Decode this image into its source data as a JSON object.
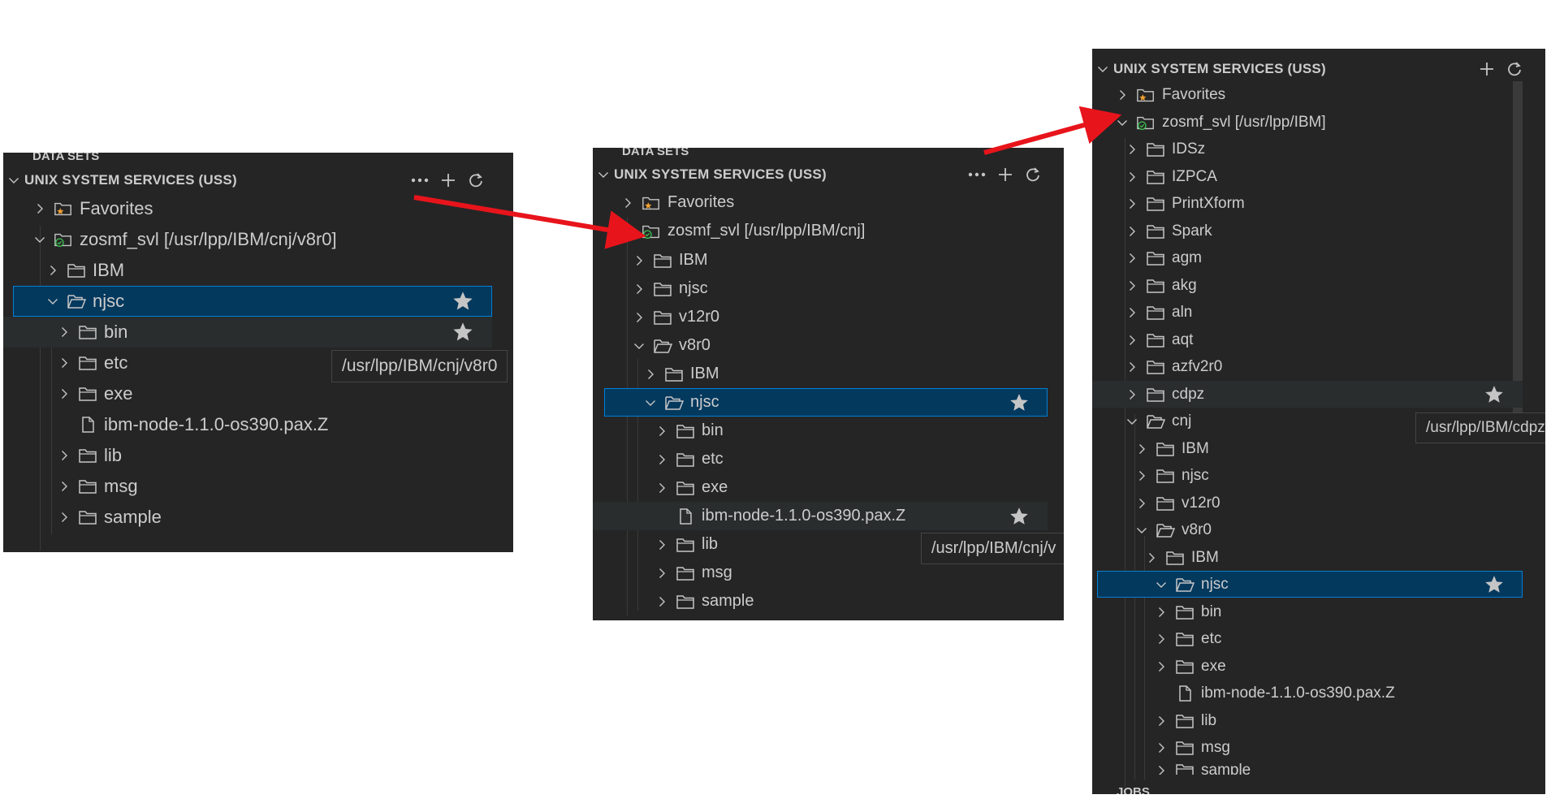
{
  "section_title": "UNIX SYSTEM SERVICES (USS)",
  "datasets_title": "DATA SETS",
  "jobs_title": "JOBS",
  "panel1": {
    "favorites": "Favorites",
    "profile": "zosmf_svl [/usr/lpp/IBM/cnj/v8r0]",
    "items": [
      "IBM",
      "njsc",
      "bin",
      "etc",
      "exe",
      "ibm-node-1.1.0-os390.pax.Z",
      "lib",
      "msg",
      "sample"
    ],
    "tooltip": "/usr/lpp/IBM/cnj/v8r0"
  },
  "panel2": {
    "favorites": "Favorites",
    "profile": "zosmf_svl [/usr/lpp/IBM/cnj]",
    "items": [
      "IBM",
      "njsc",
      "v12r0",
      "v8r0",
      "IBM",
      "njsc",
      "bin",
      "etc",
      "exe",
      "ibm-node-1.1.0-os390.pax.Z",
      "lib",
      "msg",
      "sample"
    ],
    "tooltip": "/usr/lpp/IBM/cnj/v"
  },
  "panel3": {
    "favorites": "Favorites",
    "profile": "zosmf_svl [/usr/lpp/IBM]",
    "items": [
      "IDSz",
      "IZPCA",
      "PrintXform",
      "Spark",
      "agm",
      "akg",
      "aln",
      "aqt",
      "azfv2r0",
      "cdpz",
      "cnj",
      "IBM",
      "njsc",
      "v12r0",
      "v8r0",
      "IBM",
      "njsc",
      "bin",
      "etc",
      "exe",
      "ibm-node-1.1.0-os390.pax.Z",
      "lib",
      "msg",
      "sample"
    ],
    "tooltip": "/usr/lpp/IBM/cdpz"
  },
  "colors": {
    "arrow": "#e8141b",
    "selection": "#04395e",
    "panel": "#252526",
    "focus": "#007fd4"
  }
}
